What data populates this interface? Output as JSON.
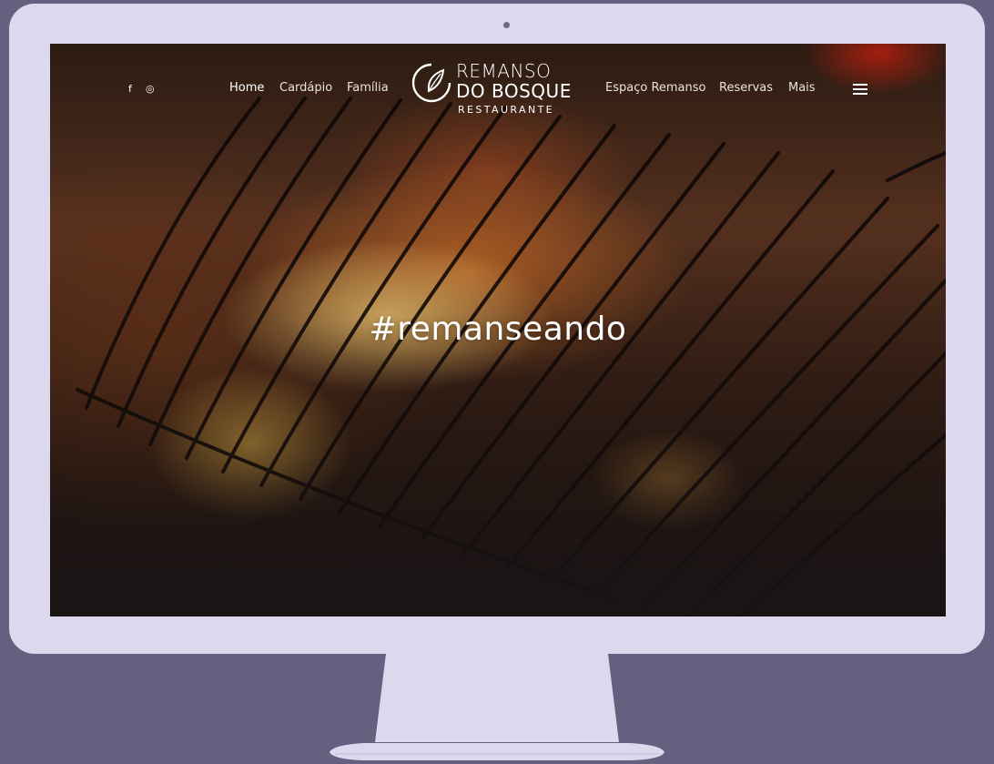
{
  "site": {
    "logo": {
      "line1": "REMANSO",
      "line2": "DO BOSQUE",
      "line3": "RESTAURANTE"
    },
    "social": {
      "facebook": "f",
      "instagram": "◎"
    },
    "nav_left": [
      {
        "label": "Home",
        "active": true
      },
      {
        "label": "Cardápio"
      },
      {
        "label": "Família"
      }
    ],
    "nav_right": [
      {
        "label": "Espaço Remanso"
      },
      {
        "label": "Reservas"
      },
      {
        "label": "Mais"
      }
    ],
    "menu_icon": "hamburger-icon"
  },
  "hero": {
    "title": "#remanseando"
  },
  "colors": {
    "backdrop": "#646180",
    "monitor": "#dcd9ee",
    "text": "#ffffff"
  }
}
